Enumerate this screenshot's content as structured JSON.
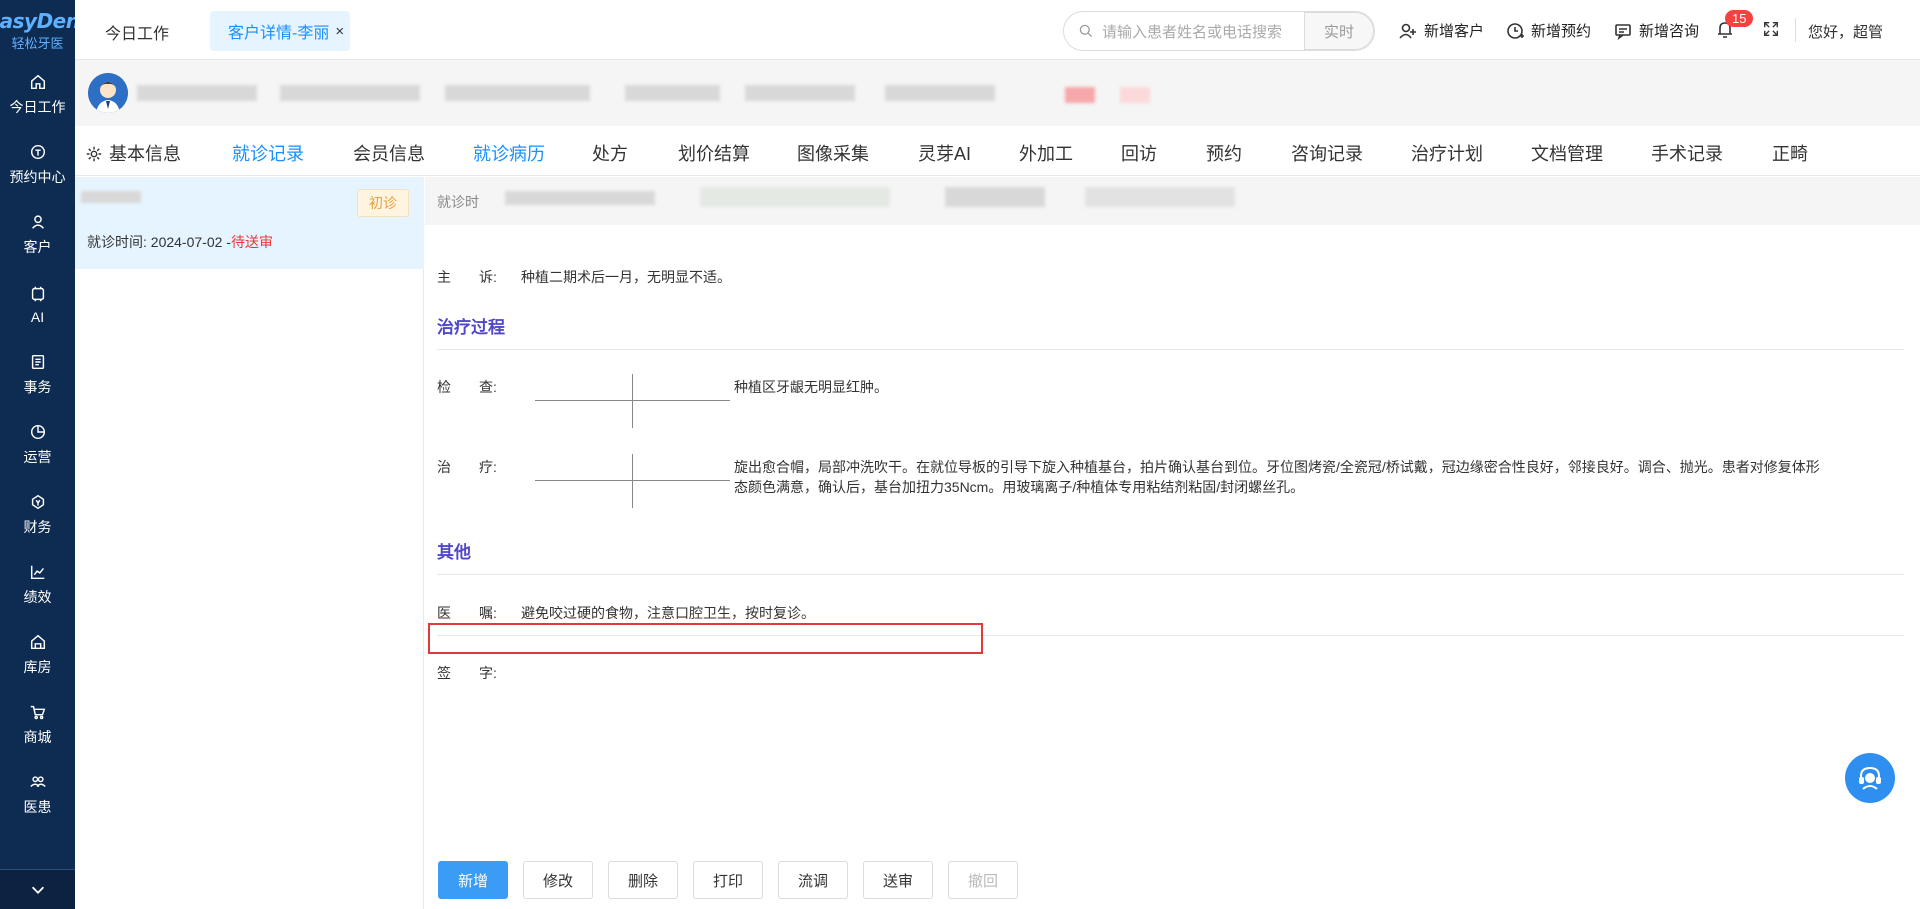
{
  "brand": {
    "name": "EasyDent",
    "sub": "轻松牙医"
  },
  "sidebar": {
    "items": [
      {
        "label": "今日工作",
        "icon": "home-icon"
      },
      {
        "label": "预约中心",
        "icon": "calendar-icon"
      },
      {
        "label": "客户",
        "icon": "user-icon"
      },
      {
        "label": "AI",
        "icon": "ai-chip-icon"
      },
      {
        "label": "事务",
        "icon": "document-icon"
      },
      {
        "label": "运营",
        "icon": "pie-chart-icon"
      },
      {
        "label": "财务",
        "icon": "finance-icon"
      },
      {
        "label": "绩效",
        "icon": "trend-icon"
      },
      {
        "label": "库房",
        "icon": "warehouse-icon"
      },
      {
        "label": "商城",
        "icon": "cart-icon"
      },
      {
        "label": "医患",
        "icon": "people-icon"
      }
    ]
  },
  "topbar": {
    "home_tab": "今日工作",
    "active_tab": "客户详情-李丽",
    "search_placeholder": "请输入患者姓名或电话搜索",
    "search_button": "实时",
    "actions": [
      "新增客户",
      "新增预约",
      "新增咨询"
    ],
    "notification_count": "15",
    "greeting": "您好，超管"
  },
  "tabs": [
    {
      "label": "基本信息"
    },
    {
      "label": "就诊记录"
    },
    {
      "label": "会员信息"
    },
    {
      "label": "就诊病历"
    },
    {
      "label": "处方"
    },
    {
      "label": "划价结算"
    },
    {
      "label": "图像采集"
    },
    {
      "label": "灵芽AI"
    },
    {
      "label": "外加工"
    },
    {
      "label": "回访"
    },
    {
      "label": "预约"
    },
    {
      "label": "咨询记录"
    },
    {
      "label": "治疗计划"
    },
    {
      "label": "文档管理"
    },
    {
      "label": "手术记录"
    },
    {
      "label": "正畸"
    }
  ],
  "visit": {
    "tag": "初诊",
    "time_label": "就诊时间: 2024-07-02 -",
    "status": "待送审"
  },
  "record": {
    "head_label": "就诊时",
    "chief_key": "主　　诉:",
    "chief_value": "种植二期术后一月，无明显不适。",
    "section_treatment": "治疗过程",
    "exam_key": "检　　查:",
    "exam_value": "种植区牙龈无明显红肿。",
    "treat_key": "治　　疗:",
    "treat_value_1": "旋出愈合帽，局部冲洗吹干。在就位导板的引导下旋入种植基台，拍片确认基台到位。牙位图烤瓷/全瓷冠/桥试戴，冠边缘密合性良好，邻接良好。调合、抛光。患者对修复体形",
    "treat_value_2": "态颜色满意，确认后，基台加扭力35Ncm。用玻璃离子/种植体专用粘结剂粘固/封闭螺丝孔。",
    "section_other": "其他",
    "advice_key": "医　　嘱:",
    "advice_value": "避免咬过硬的食物，注意口腔卫生，按时复诊。",
    "sign_key": "签　　字:"
  },
  "buttons": [
    "新增",
    "修改",
    "删除",
    "打印",
    "流调",
    "送审",
    "撤回"
  ],
  "colors": {
    "accent": "#1890ff",
    "sidebar": "#0e2c52",
    "section": "#5048c8",
    "pending": "#e4393c"
  }
}
